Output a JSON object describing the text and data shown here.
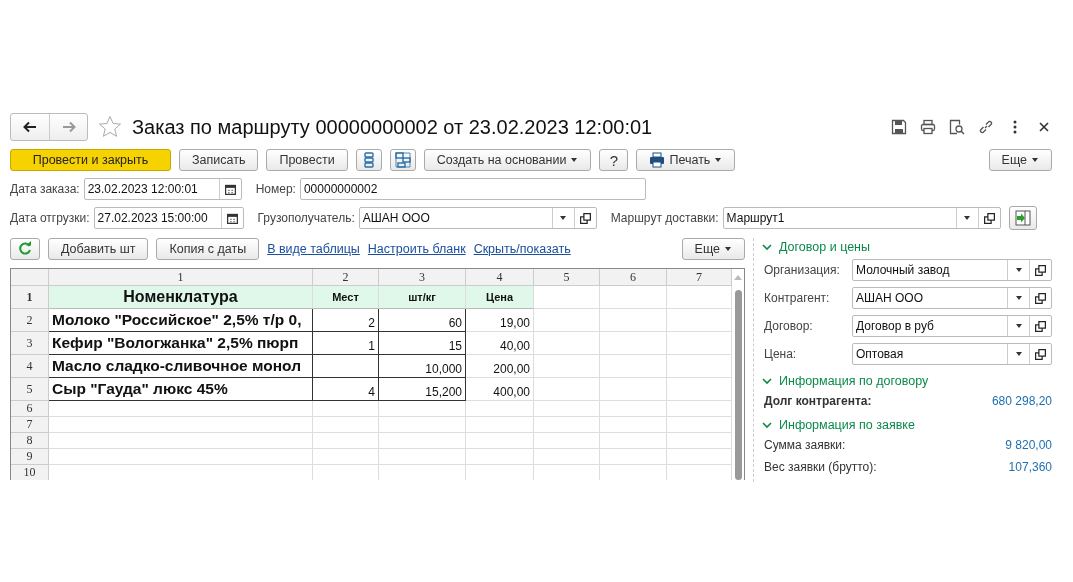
{
  "window": {
    "title": "Заказ по маршруту 00000000002 от 23.02.2023 12:00:01",
    "favorite": false
  },
  "toolbar": [
    {
      "kind": "primary",
      "label": "Провести и закрыть"
    },
    {
      "kind": "button",
      "label": "Записать"
    },
    {
      "kind": "button",
      "label": "Провести"
    },
    {
      "kind": "list-icon"
    },
    {
      "kind": "structure-icon"
    },
    {
      "kind": "menu",
      "label": "Создать на основании"
    },
    {
      "kind": "button",
      "label": "?"
    },
    {
      "kind": "print-menu",
      "label": "Печать"
    }
  ],
  "toolbar_more": "Еще",
  "header_fields": [
    [
      {
        "label": "Дата заказа:",
        "value": "23.02.2023 12:00:01",
        "kind": "date"
      },
      {
        "label": "Номер:",
        "value": "00000000002",
        "kind": "text"
      }
    ],
    [
      {
        "label": "Дата отгрузки:",
        "value": "27.02.2023 15:00:00",
        "kind": "date"
      },
      {
        "label": "Грузополучатель:",
        "value": "АШАН ООО",
        "kind": "select"
      },
      {
        "label": "Маршрут доставки:",
        "value": "Маршрут1",
        "kind": "select"
      }
    ]
  ],
  "grid_toolbar": [
    {
      "kind": "refresh-icon"
    },
    {
      "kind": "button",
      "label": "Добавить шт"
    },
    {
      "kind": "button",
      "label": "Копия с даты"
    },
    {
      "kind": "link",
      "label": "В виде таблицы"
    },
    {
      "kind": "link",
      "label": "Настроить бланк"
    },
    {
      "kind": "link",
      "label": "Скрыть/показать"
    }
  ],
  "grid_more": "Еще",
  "grid": {
    "columns": [
      "1",
      "2",
      "3",
      "4",
      "5",
      "6",
      "7"
    ],
    "rows": [
      {
        "num": "1",
        "kind": "header",
        "cells": [
          "Номенклатура",
          "Мест",
          "шт/кг",
          "Цена"
        ]
      },
      {
        "num": "2",
        "kind": "item",
        "cells": [
          "Молоко \"Российское\" 2,5% т/р 0,",
          "2",
          "60",
          "19,00"
        ]
      },
      {
        "num": "3",
        "kind": "item",
        "cells": [
          "Кефир \"Вологжанка\" 2,5% пюрп",
          "1",
          "15",
          "40,00"
        ]
      },
      {
        "num": "4",
        "kind": "item",
        "cells": [
          "Масло сладко-сливочное монол",
          null,
          "10,000",
          "200,00"
        ]
      },
      {
        "num": "5",
        "kind": "item",
        "cells": [
          "Сыр \"Гауда\" люкс 45%",
          "4",
          "15,200",
          "400,00"
        ]
      },
      {
        "num": "6",
        "kind": "empty"
      },
      {
        "num": "7",
        "kind": "empty"
      },
      {
        "num": "8",
        "kind": "empty"
      },
      {
        "num": "9",
        "kind": "empty"
      },
      {
        "num": "10",
        "kind": "empty"
      }
    ]
  },
  "sections": [
    {
      "title": "Договор и цены",
      "expanded": true,
      "kind": "fields",
      "rows": [
        {
          "label": "Организация:",
          "value": "Молочный завод"
        },
        {
          "label": "Контрагент:",
          "value": "АШАН ООО"
        },
        {
          "label": "Договор:",
          "value": "Договор в руб"
        },
        {
          "label": "Цена:",
          "value": "Оптовая"
        }
      ]
    },
    {
      "title": "Информация по договору",
      "expanded": true,
      "kind": "info",
      "rows": [
        {
          "label": "Долг контрагента:",
          "value": "680 298,20",
          "bold": true
        }
      ]
    },
    {
      "title": "Информация по заявке",
      "expanded": true,
      "kind": "info",
      "rows": [
        {
          "label": "Сумма заявки:",
          "value": "9 820,00",
          "bold": false
        },
        {
          "label": "Вес заявки (брутто):",
          "value": "107,360",
          "bold": false
        }
      ]
    }
  ]
}
